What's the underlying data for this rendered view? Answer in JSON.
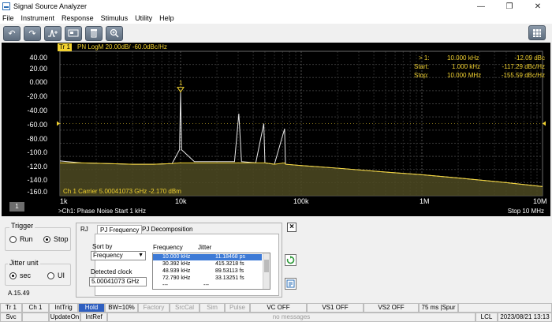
{
  "window": {
    "title": "Signal Source Analyzer",
    "controls": [
      "—",
      "❐",
      "✕"
    ]
  },
  "menu": [
    "File",
    "Instrument",
    "Response",
    "Stimulus",
    "Utility",
    "Help"
  ],
  "toolbar": {
    "buttons": [
      "undo-icon",
      "redo-icon",
      "marker-add-icon",
      "screenshot-icon",
      "delete-icon",
      "zoom-icon",
      "keypad-icon"
    ]
  },
  "trace": {
    "tag": "Tr 1",
    "title": "PN LogM 20.00dB/ -60.0dBc/Hz",
    "number": "1"
  },
  "yticks": [
    "40.00",
    "20.00",
    "0.000",
    "-20.00",
    "-40.00",
    "-60.00",
    "-80.00",
    "-100.0",
    "-120.0",
    "-140.0",
    "-160.0"
  ],
  "xticks": [
    "1k",
    "10k",
    "100k",
    "1M",
    "10M"
  ],
  "marker": {
    "label": "1",
    "rows": [
      {
        "name": "> 1:",
        "freq": "10.000  kHz",
        "value": "-12.09 dBc"
      },
      {
        "name": "Start:",
        "freq": "1.000  kHz",
        "value": "-117.29 dBc/Hz"
      },
      {
        "name": "Stop:",
        "freq": "10.000  MHz",
        "value": "-155.59 dBc/Hz"
      }
    ]
  },
  "carrier": "Ch 1  Carrier 5.00041073 GHz   -2.170 dBm",
  "bottom": {
    "left": ">Ch1: Phase Noise  Start  1 kHz",
    "right": "Stop  10 MHz"
  },
  "trigger": {
    "title": "Trigger",
    "run": "Run",
    "stop": "Stop"
  },
  "jitter_unit": {
    "title": "Jitter unit",
    "sec": "sec",
    "ui": "UI"
  },
  "version": "A.15.49",
  "tabs": [
    "RJ",
    "PJ Frequency",
    "PJ Decomposition"
  ],
  "pj": {
    "sort_label": "Sort by",
    "sort_value": "Frequency",
    "detected_label": "Detected clock",
    "detected_value": "5.00041073 GHz",
    "col_freq": "Frequency",
    "col_jitter": "Jitter",
    "rows": [
      {
        "freq": "10.000 kHz",
        "jitter": "11.18468 ps"
      },
      {
        "freq": "30.392 kHz",
        "jitter": "415.3218 fs"
      },
      {
        "freq": "48.939 kHz",
        "jitter": "89.53113 fs"
      },
      {
        "freq": "72.790 kHz",
        "jitter": "33.13251 fs"
      },
      {
        "freq": "---",
        "jitter": "---"
      }
    ]
  },
  "status1": [
    {
      "label": "Tr 1",
      "style": "",
      "w": 28
    },
    {
      "label": "Ch 1",
      "style": "",
      "w": 34
    },
    {
      "label": "IntTrig",
      "style": "",
      "w": 37
    },
    {
      "label": "Hold",
      "style": "hold",
      "w": 34
    },
    {
      "label": "BW=10%",
      "style": "",
      "w": 42
    },
    {
      "label": "Factory",
      "style": "dim",
      "w": 40
    },
    {
      "label": "SrcCal",
      "style": "dim",
      "w": 38
    },
    {
      "label": "Sim",
      "style": "dim",
      "w": 32
    },
    {
      "label": "Pulse",
      "style": "dim",
      "w": 32
    },
    {
      "label": "VC OFF",
      "style": "",
      "w": 72
    },
    {
      "label": "VS1 OFF",
      "style": "",
      "w": 72
    },
    {
      "label": "VS2 OFF",
      "style": "",
      "w": 70
    },
    {
      "label": "75 ms |Spur",
      "style": "",
      "w": 50
    },
    {
      "label": "",
      "style": "",
      "w": 119
    }
  ],
  "status2": [
    {
      "label": "Svc",
      "style": "",
      "w": 28
    },
    {
      "label": "",
      "style": "",
      "w": 34
    },
    {
      "label": "UpdateOn",
      "style": "",
      "w": 40
    },
    {
      "label": "IntRef",
      "style": "",
      "w": 34
    },
    {
      "label": "no messages",
      "style": "dim",
      "w": 467
    },
    {
      "label": "LCL",
      "style": "",
      "w": 28
    },
    {
      "label": "2023/08/21 13:13",
      "style": "",
      "w": 69
    }
  ],
  "chart_data": {
    "type": "line",
    "title": "PN LogM 20.00dB/ -60.0dBc/Hz",
    "xlabel": "",
    "ylabel": "",
    "xscale": "log",
    "xlim": [
      1000,
      10000000
    ],
    "ylim": [
      -170,
      50
    ],
    "series": [
      {
        "x": [
          1000,
          1500,
          2500,
          4000,
          6000,
          8500,
          9800,
          10000,
          10200,
          13000,
          20000,
          28000,
          30392,
          32000,
          42000,
          48939,
          50000,
          60000,
          72790,
          74000,
          100000,
          200000,
          500000,
          1000000,
          2000000,
          5000000,
          10000000
        ],
        "y": [
          -117,
          -120,
          -121,
          -122,
          -122,
          -121,
          -100,
          -12,
          -100,
          -118,
          -118,
          -118,
          -45,
          -118,
          -120,
          -60,
          -120,
          -122,
          -68,
          -122,
          -124,
          -128,
          -134,
          -138,
          -143,
          -150,
          -156
        ]
      }
    ]
  }
}
